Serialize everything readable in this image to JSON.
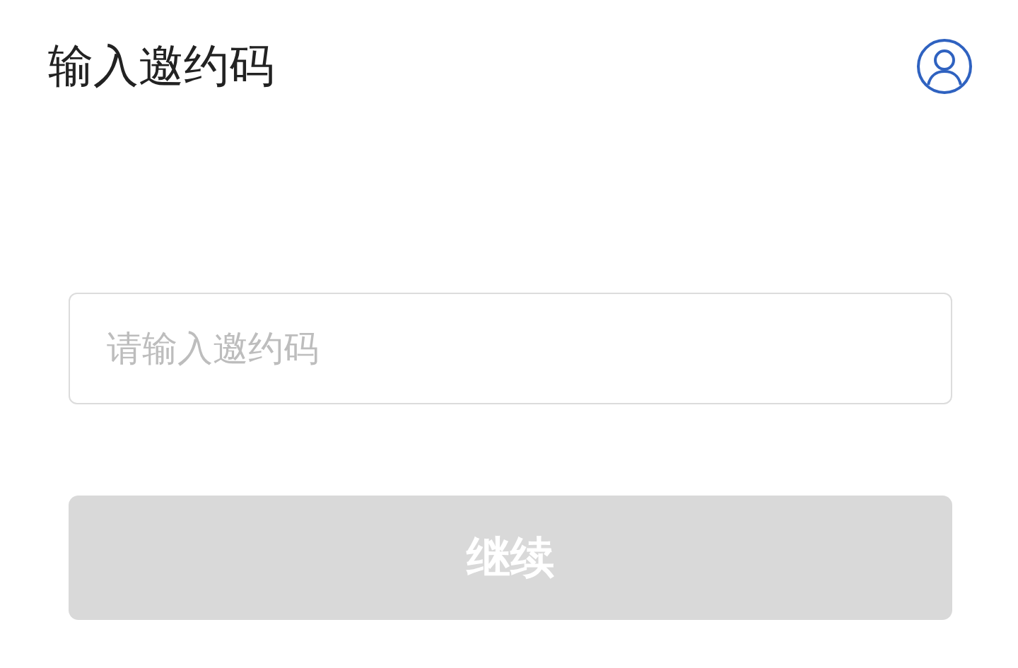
{
  "header": {
    "title": "输入邀约码"
  },
  "invite_field": {
    "placeholder": "请输入邀约码"
  },
  "continue_button": {
    "label": "继续",
    "disabled": true
  }
}
